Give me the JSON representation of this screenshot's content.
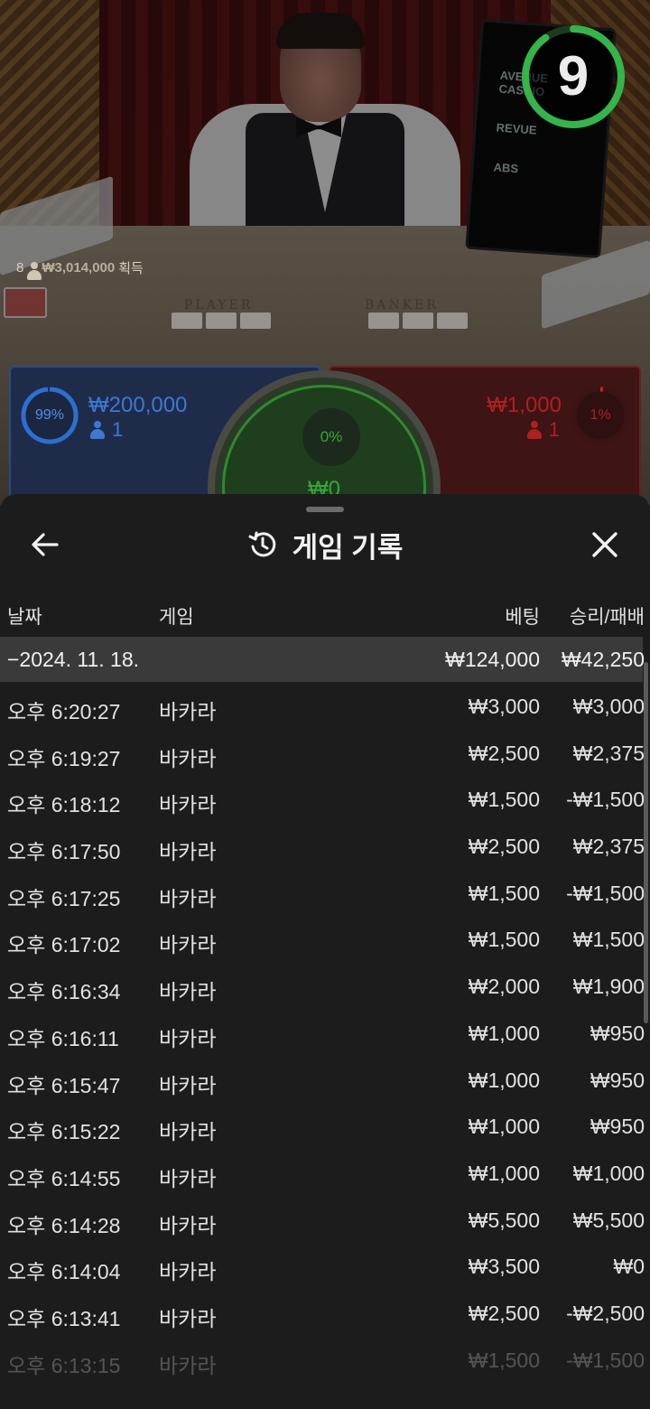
{
  "stream": {
    "timer": "9",
    "table_labels": {
      "player": "PLAYER",
      "banker": "BANKER"
    },
    "players_count": "8",
    "winnings_amount": "₩3,014,000",
    "winnings_suffix": "획득",
    "monitor_logos": [
      "AVENUE CASINO",
      "REVUE",
      "ABS"
    ]
  },
  "bets": {
    "player": {
      "percent": "99%",
      "amount": "₩200,000",
      "count": "1",
      "color": "#2b6fd1"
    },
    "tie": {
      "percent": "0%",
      "amount": "₩0",
      "color": "#2d9e2d"
    },
    "banker": {
      "percent": "1%",
      "amount": "₩1,000",
      "count": "1",
      "color": "#c62626"
    }
  },
  "history": {
    "title": "게임 기록",
    "columns": {
      "date": "날짜",
      "game": "게임",
      "bet": "베팅",
      "win_loss": "승리/패배"
    },
    "group": {
      "label": "−2024. 11. 18.",
      "bet_total": "₩124,000",
      "win_total": "₩42,250"
    },
    "rows": [
      {
        "time": "오후 6:20:27",
        "game": "바카라",
        "bet": "₩3,000",
        "result": "₩3,000"
      },
      {
        "time": "오후 6:19:27",
        "game": "바카라",
        "bet": "₩2,500",
        "result": "₩2,375"
      },
      {
        "time": "오후 6:18:12",
        "game": "바카라",
        "bet": "₩1,500",
        "result": "-₩1,500"
      },
      {
        "time": "오후 6:17:50",
        "game": "바카라",
        "bet": "₩2,500",
        "result": "₩2,375"
      },
      {
        "time": "오후 6:17:25",
        "game": "바카라",
        "bet": "₩1,500",
        "result": "-₩1,500"
      },
      {
        "time": "오후 6:17:02",
        "game": "바카라",
        "bet": "₩1,500",
        "result": "₩1,500"
      },
      {
        "time": "오후 6:16:34",
        "game": "바카라",
        "bet": "₩2,000",
        "result": "₩1,900"
      },
      {
        "time": "오후 6:16:11",
        "game": "바카라",
        "bet": "₩1,000",
        "result": "₩950"
      },
      {
        "time": "오후 6:15:47",
        "game": "바카라",
        "bet": "₩1,000",
        "result": "₩950"
      },
      {
        "time": "오후 6:15:22",
        "game": "바카라",
        "bet": "₩1,000",
        "result": "₩950"
      },
      {
        "time": "오후 6:14:55",
        "game": "바카라",
        "bet": "₩1,000",
        "result": "₩1,000"
      },
      {
        "time": "오후 6:14:28",
        "game": "바카라",
        "bet": "₩5,500",
        "result": "₩5,500"
      },
      {
        "time": "오후 6:14:04",
        "game": "바카라",
        "bet": "₩3,500",
        "result": "₩0"
      },
      {
        "time": "오후 6:13:41",
        "game": "바카라",
        "bet": "₩2,500",
        "result": "-₩2,500"
      },
      {
        "time": "오후 6:13:15",
        "game": "바카라",
        "bet": "₩1,500",
        "result": "-₩1,500"
      }
    ]
  },
  "icons": {
    "back": "arrow-left-icon",
    "history": "history-icon",
    "close": "close-icon"
  }
}
